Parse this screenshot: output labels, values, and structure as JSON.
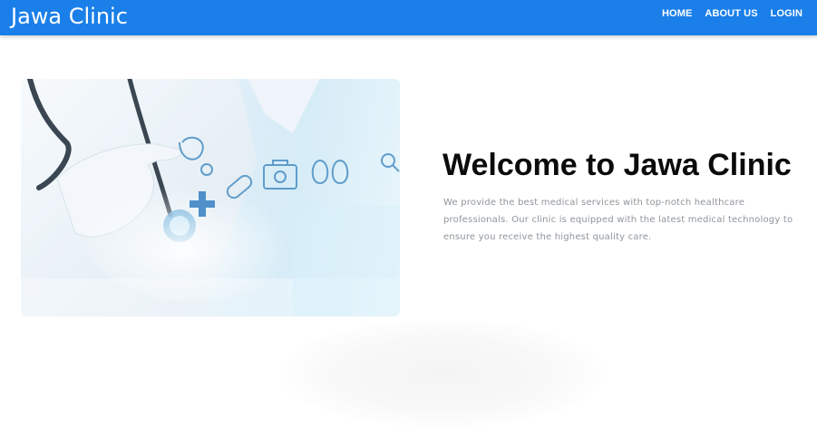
{
  "navbar": {
    "brand": "Jawa Clinic",
    "links": [
      "HOME",
      "ABOUT US",
      "LOGIN"
    ],
    "background_color": "#1a7fe8"
  },
  "hero": {
    "title": "Welcome to Jawa Clinic",
    "description": "We provide the best medical services with top-notch healthcare professionals. Our clinic is equipped with the latest medical technology to ensure you receive the highest quality care.",
    "image_subject": "doctor-with-stethoscope-medical-icons"
  }
}
